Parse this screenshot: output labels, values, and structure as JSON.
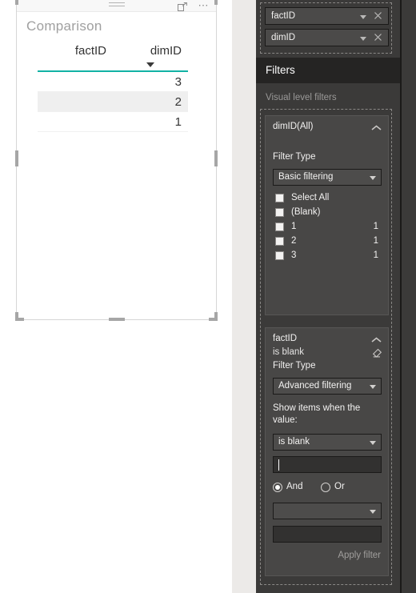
{
  "canvas": {
    "visual": {
      "title": "Comparison",
      "header_icons": {
        "drag_handle": "drag-handle-icon",
        "focus_mode": "focus-mode-icon",
        "more_options": "more-options-icon"
      },
      "table": {
        "columns": [
          "factID",
          "dimID"
        ],
        "sorted_column": "dimID",
        "sort_direction": "descending",
        "underline_color": "#11b2a4",
        "rows": [
          {
            "factID": "",
            "dimID": "3",
            "highlighted": false
          },
          {
            "factID": "",
            "dimID": "2",
            "highlighted": true
          },
          {
            "factID": "",
            "dimID": "1",
            "highlighted": false
          }
        ]
      }
    }
  },
  "pane": {
    "fields": {
      "items": [
        {
          "label": "factID"
        },
        {
          "label": "dimID"
        }
      ],
      "chevron_icon": "chevron-down-icon",
      "remove_icon": "close-icon"
    },
    "filters": {
      "header": "Filters",
      "section_label": "Visual level filters",
      "cards": [
        {
          "title": "dimID(All)",
          "collapse_icon": "chevron-up-icon",
          "filter_type_label": "Filter Type",
          "filter_type_value": "Basic filtering",
          "values": [
            {
              "label": "Select All",
              "count": "",
              "checked": false
            },
            {
              "label": "(Blank)",
              "count": "",
              "checked": false
            },
            {
              "label": "1",
              "count": "1",
              "checked": false
            },
            {
              "label": "2",
              "count": "1",
              "checked": false
            },
            {
              "label": "3",
              "count": "1",
              "checked": false
            }
          ]
        },
        {
          "title": "factID",
          "subtitle": "is blank",
          "collapse_icon": "chevron-up-icon",
          "clear_icon": "eraser-icon",
          "filter_type_label": "Filter Type",
          "filter_type_value": "Advanced filtering",
          "condition_label": "Show items when the value:",
          "condition1_value": "is blank",
          "condition1_input": "",
          "operator_and": "And",
          "operator_or": "Or",
          "operator_selected": "And",
          "condition2_value": "",
          "condition2_input": "",
          "apply_label": "Apply filter"
        }
      ]
    }
  }
}
